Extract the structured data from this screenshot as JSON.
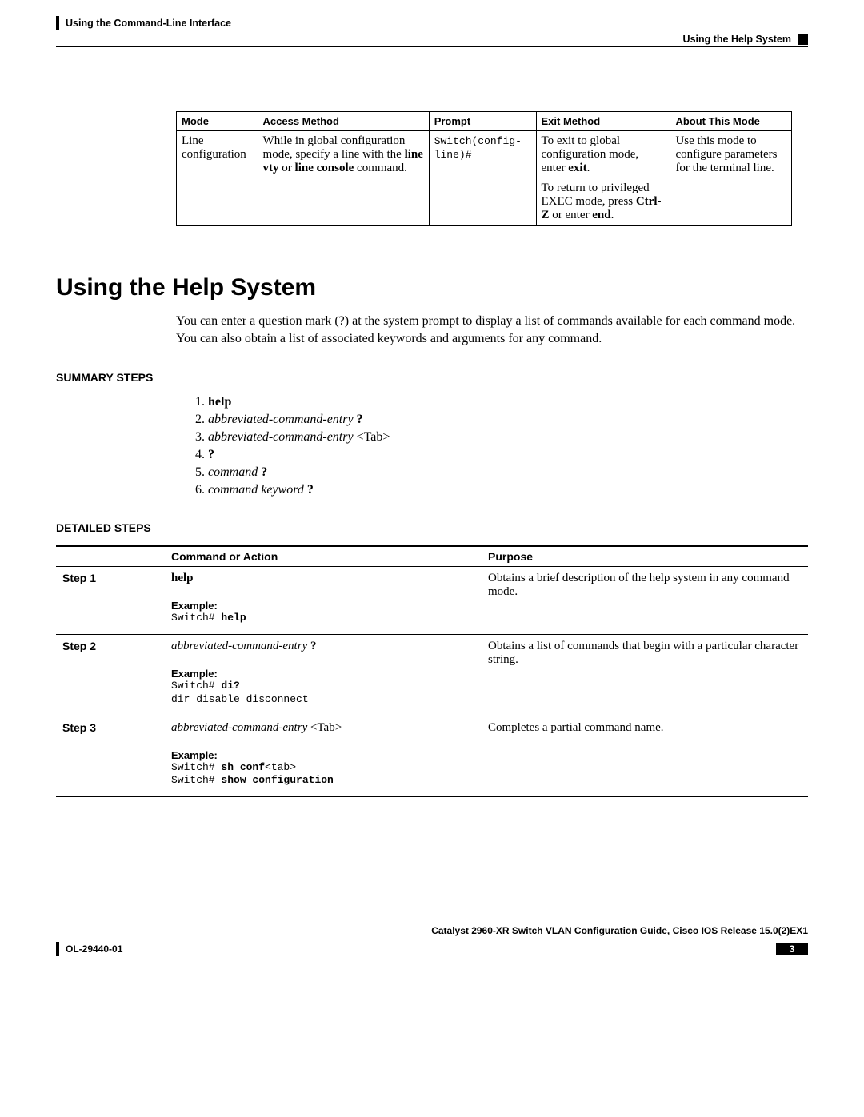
{
  "header": {
    "chapter": "Using the Command-Line Interface",
    "section": "Using the Help System"
  },
  "mode_table": {
    "headers": {
      "mode": "Mode",
      "access": "Access Method",
      "prompt": "Prompt",
      "exit": "Exit Method",
      "about": "About This Mode"
    },
    "row": {
      "mode": "Line configuration",
      "access_pre": "While in global configuration mode, specify a line with the ",
      "access_b1": "line vty",
      "access_mid": " or ",
      "access_b2": "line console",
      "access_post": " command.",
      "prompt": "Switch(config-line)#",
      "exit1_pre": "To exit to global configuration mode, enter ",
      "exit1_b": "exit",
      "exit1_post": ".",
      "exit2_pre": "To return to privileged EXEC mode, press ",
      "exit2_b": "Ctrl-Z",
      "exit2_mid": " or enter ",
      "exit2_b2": "end",
      "exit2_post": ".",
      "about": "Use this mode to configure parameters for the terminal line."
    }
  },
  "h1": "Using the Help System",
  "intro": "You can enter a question mark (?) at the system prompt to display a list of commands available for each command mode. You can also obtain a list of associated keywords and arguments for any command.",
  "summary_label": "SUMMARY STEPS",
  "summary": {
    "s1": "help",
    "s2_i": "abbreviated-command-entry",
    "s2_r": " ?",
    "s3_i": "abbreviated-command-entry",
    "s3_r": " <Tab>",
    "s4": "?",
    "s5_i": "command",
    "s5_r": " ?",
    "s6_i": "command keyword",
    "s6_r": " ?"
  },
  "detailed_label": "DETAILED STEPS",
  "det_headers": {
    "blank": "",
    "cmd": "Command or Action",
    "purpose": "Purpose"
  },
  "steps": {
    "s1": {
      "label": "Step 1",
      "cmd_b": "help",
      "ex_label": "Example:",
      "ex_line1_p": "Switch# ",
      "ex_line1_b": "help",
      "purpose": "Obtains a brief description of the help system in any command mode."
    },
    "s2": {
      "label": "Step 2",
      "cmd_i": "abbreviated-command-entry",
      "cmd_b": " ?",
      "ex_label": "Example:",
      "ex_line1_p": "Switch# ",
      "ex_line1_b": "di?",
      "ex_line2": "dir disable disconnect",
      "purpose": "Obtains a list of commands that begin with a particular character string."
    },
    "s3": {
      "label": "Step 3",
      "cmd_i": "abbreviated-command-entry",
      "cmd_r": " <Tab>",
      "ex_label": "Example:",
      "ex_line1_p": "Switch# ",
      "ex_line1_b": "sh conf",
      "ex_line1_r": "<tab>",
      "ex_line2_p": "Switch# ",
      "ex_line2_b": "show configuration",
      "purpose": "Completes a partial command name."
    }
  },
  "footer": {
    "title": "Catalyst 2960-XR Switch VLAN Configuration Guide, Cisco IOS Release 15.0(2)EX1",
    "doc_id": "OL-29440-01",
    "page": "3"
  }
}
